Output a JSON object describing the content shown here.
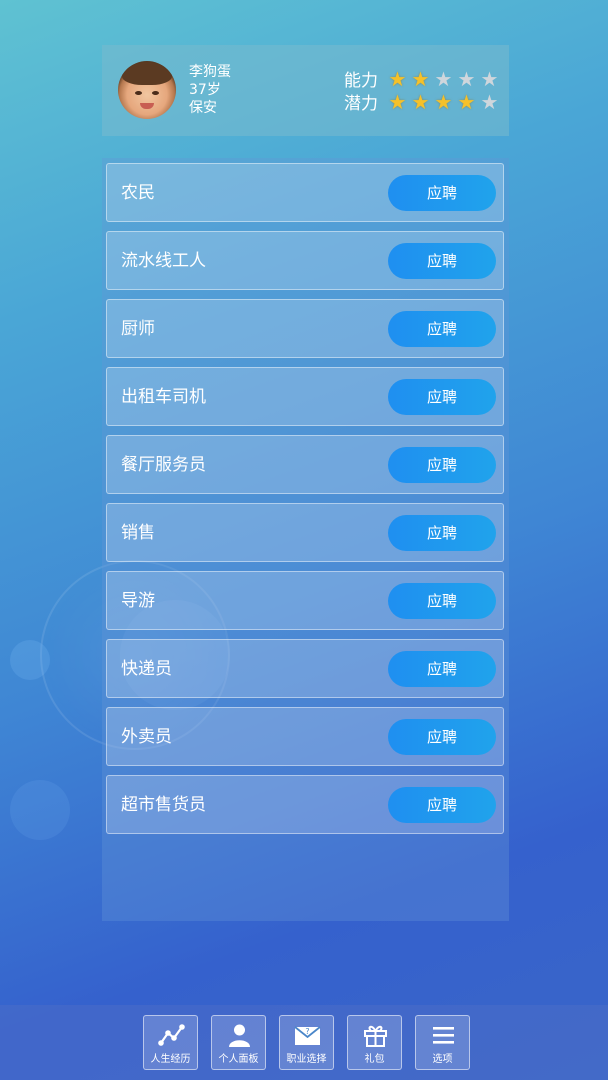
{
  "profile": {
    "name": "李狗蛋",
    "age": "37岁",
    "job": "保安",
    "ability_label": "能力",
    "potential_label": "潜力",
    "ability_stars": 2,
    "potential_stars": 4,
    "max_stars": 5
  },
  "jobs": [
    {
      "name": "农民",
      "action": "应聘"
    },
    {
      "name": "流水线工人",
      "action": "应聘"
    },
    {
      "name": "厨师",
      "action": "应聘"
    },
    {
      "name": "出租车司机",
      "action": "应聘"
    },
    {
      "name": "餐厅服务员",
      "action": "应聘"
    },
    {
      "name": "销售",
      "action": "应聘"
    },
    {
      "name": "导游",
      "action": "应聘"
    },
    {
      "name": "快递员",
      "action": "应聘"
    },
    {
      "name": "外卖员",
      "action": "应聘"
    },
    {
      "name": "超市售货员",
      "action": "应聘"
    }
  ],
  "nav": [
    {
      "label": "人生经历",
      "icon": "chart-line-icon"
    },
    {
      "label": "个人面板",
      "icon": "person-icon"
    },
    {
      "label": "职业选择",
      "icon": "envelope-icon"
    },
    {
      "label": "礼包",
      "icon": "gift-icon"
    },
    {
      "label": "选项",
      "icon": "menu-icon"
    }
  ],
  "colors": {
    "star_on": "#f5c12a",
    "star_off": "#cfd6dc",
    "apply_button": "#1f8ff0"
  }
}
